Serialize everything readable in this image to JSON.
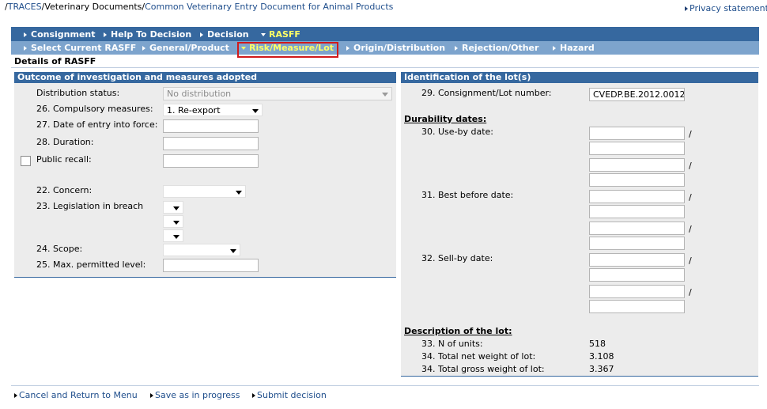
{
  "breadcrumb": {
    "sep": "/",
    "traces": "TRACES",
    "vet_docs": "Veterinary Documents",
    "current": "Common Veterinary Entry Document for Animal Products"
  },
  "privacy_label": "Privacy statement",
  "main_tabs": [
    "Consignment",
    "Help To Decision",
    "Decision",
    "RASFF"
  ],
  "sub_tabs": [
    "Select Current RASFF",
    "General/Product",
    "Risk/Measure/Lot",
    "Origin/Distribution",
    "Rejection/Other",
    "Hazard"
  ],
  "section_title": "Details of RASFF",
  "left": {
    "title": "Outcome of investigation and measures adopted",
    "distribution_status_label": "Distribution status:",
    "distribution_status_value": "No distribution",
    "compulsory_label": "26. Compulsory measures:",
    "compulsory_value": "1. Re-export",
    "entry_date_label": "27. Date of entry into force:",
    "duration_label": "28. Duration:",
    "public_recall_label": "Public recall:",
    "concern_label": "22. Concern:",
    "legislation_label": "23. Legislation in breach",
    "scope_label": "24. Scope:",
    "max_level_label": "25. Max. permitted level:"
  },
  "right": {
    "title": "Identification of the lot(s)",
    "lot_number_label": "29. Consignment/Lot number:",
    "lot_number_value": "CVEDP.BE.2012.0012",
    "durability_heading": "Durability dates:",
    "use_by_label": "30. Use-by date:",
    "best_before_label": "31. Best before date:",
    "sell_by_label": "32. Sell-by date:",
    "slash": "/",
    "description_heading": "Description of the lot:",
    "units_label": "33. N of units:",
    "units_value": "518",
    "net_weight_label": "34. Total net weight of lot:",
    "net_weight_value": "3.108",
    "gross_weight_label": "34. Total gross weight of lot:",
    "gross_weight_value": "3.367"
  },
  "footer": [
    "Cancel and Return to Menu",
    "Save as in progress",
    "Submit decision"
  ],
  "colors": {
    "tab_bar": "#36689f",
    "sub_tab_bar": "#7da4cd",
    "active_tab": "#ffff66",
    "highlight_box": "#d11a1a",
    "link": "#1f4e8c"
  }
}
